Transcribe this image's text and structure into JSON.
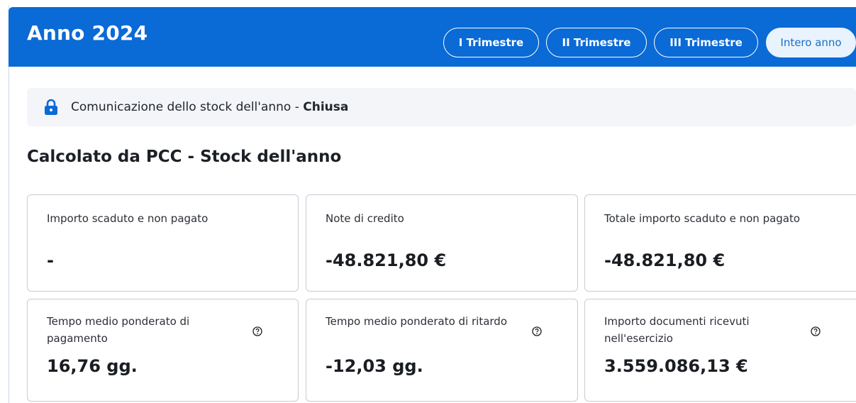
{
  "header": {
    "title": "Anno 2024",
    "tabs": [
      {
        "label": "I Trimestre",
        "active": false
      },
      {
        "label": "II Trimestre",
        "active": false
      },
      {
        "label": "III Trimestre",
        "active": false
      },
      {
        "label": "Intero anno",
        "active": true
      }
    ],
    "color": "#0a6ad6"
  },
  "notice": {
    "icon": "lock-icon",
    "text": "Comunicazione dello stock dell'anno - ",
    "status": "Chiusa"
  },
  "section": {
    "title": "Calcolato da PCC - Stock dell'anno"
  },
  "cards": [
    {
      "label": "Importo scaduto e non pagato",
      "value": "-",
      "help": false
    },
    {
      "label": "Note di credito",
      "value": "-48.821,80 €",
      "help": false
    },
    {
      "label": "Totale importo scaduto e non pagato",
      "value": "-48.821,80 €",
      "help": false
    },
    {
      "label": "Tempo medio ponderato di pagamento",
      "value": "16,76 gg.",
      "help": true
    },
    {
      "label": "Tempo medio ponderato di ritardo",
      "value": "-12,03 gg.",
      "help": true
    },
    {
      "label": "Importo documenti ricevuti nell'esercizio",
      "value": "3.559.086,13 €",
      "help": true
    }
  ]
}
